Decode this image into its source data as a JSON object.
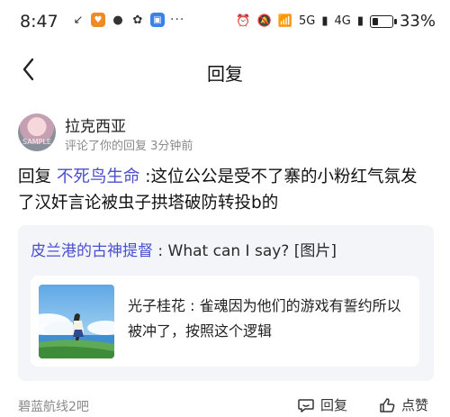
{
  "status_bar": {
    "time": "8:47",
    "network_label": "5G",
    "network_label_2": "4G",
    "battery_text": "33%",
    "battery_level": 0.33
  },
  "nav": {
    "title": "回复"
  },
  "comment": {
    "username": "拉克西亚",
    "avatar_watermark": "SAMPLE",
    "meta": "评论了你的回复  3分钟前",
    "reply_prefix": "回复 ",
    "mention": "不死鸟生命",
    "reply_body": " :这位公公是受不了寨的小粉红气氛发了汉奸言论被虫子拱塔破防转投b的"
  },
  "quote": {
    "author": "皮兰港的古神提督",
    "text": " : What can I say? [图片]",
    "inner": {
      "author": "光子桂花",
      "text": " : 雀魂因为他们的游戏有誓约所以被冲了，按照这个逻辑"
    }
  },
  "footer": {
    "forum": "碧蓝航线2吧",
    "reply_label": "回复",
    "like_label": "点赞"
  }
}
